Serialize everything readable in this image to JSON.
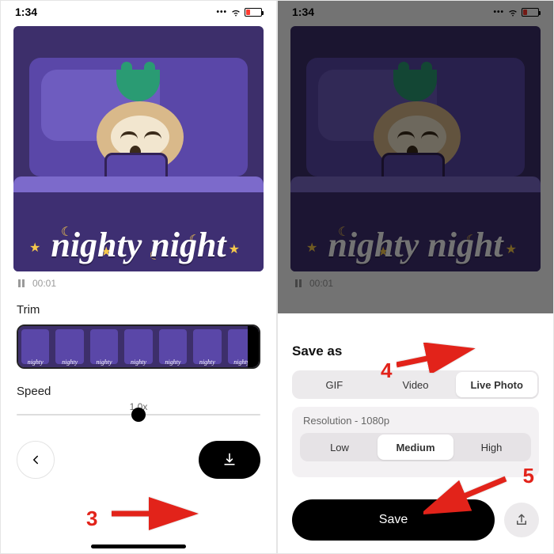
{
  "status": {
    "time": "1:34"
  },
  "player": {
    "timestamp": "00:01"
  },
  "media": {
    "caption": "nighty night"
  },
  "trim": {
    "label": "Trim"
  },
  "speed": {
    "label": "Speed",
    "value": "1.0x"
  },
  "saveSheet": {
    "title": "Save as",
    "formats": {
      "gif": "GIF",
      "video": "Video",
      "live": "Live Photo"
    },
    "resolutionLabel": "Resolution - 1080p",
    "quality": {
      "low": "Low",
      "medium": "Medium",
      "high": "High"
    },
    "saveLabel": "Save"
  },
  "annotations": {
    "step3": "3",
    "step4": "4",
    "step5": "5"
  }
}
